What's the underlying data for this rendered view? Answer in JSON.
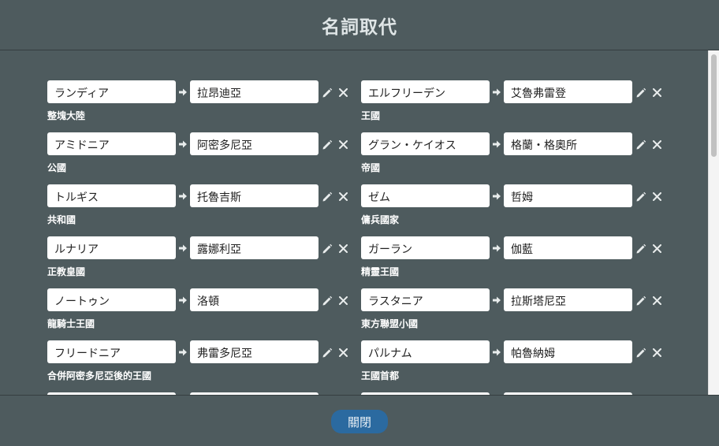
{
  "dialog": {
    "title": "名詞取代",
    "close_label": "關閉"
  },
  "entries": [
    {
      "src": "ランディア",
      "dst": "拉昂迪亞",
      "desc": "整塊大陸"
    },
    {
      "src": "エルフリーデン",
      "dst": "艾魯弗雷登",
      "desc": "王國"
    },
    {
      "src": "アミドニア",
      "dst": "阿密多尼亞",
      "desc": "公國"
    },
    {
      "src": "グラン・ケイオス",
      "dst": "格蘭・格奧所",
      "desc": "帝國"
    },
    {
      "src": "トルギス",
      "dst": "托魯吉斯",
      "desc": "共和國"
    },
    {
      "src": "ゼム",
      "dst": "哲姆",
      "desc": "傭兵國家"
    },
    {
      "src": "ルナリア",
      "dst": "露娜利亞",
      "desc": "正教皇國"
    },
    {
      "src": "ガーラン",
      "dst": "伽藍",
      "desc": "精靈王國"
    },
    {
      "src": "ノートゥン",
      "dst": "洛頓",
      "desc": "龍騎士王國"
    },
    {
      "src": "ラスタニア",
      "dst": "拉斯塔尼亞",
      "desc": "東方聯盟小國"
    },
    {
      "src": "フリードニア",
      "dst": "弗雷多尼亞",
      "desc": "合併阿密多尼亞後的王國"
    },
    {
      "src": "パルナム",
      "dst": "帕魯納姆",
      "desc": "王國首都"
    },
    {
      "src": "",
      "dst": "",
      "desc": ""
    },
    {
      "src": "",
      "dst": "",
      "desc": ""
    }
  ],
  "icons": {
    "arrow": "arrow-right-icon",
    "edit": "pencil-icon",
    "delete": "close-icon"
  },
  "colors": {
    "background": "#4e5b5e",
    "button": "#2b6aa0"
  }
}
